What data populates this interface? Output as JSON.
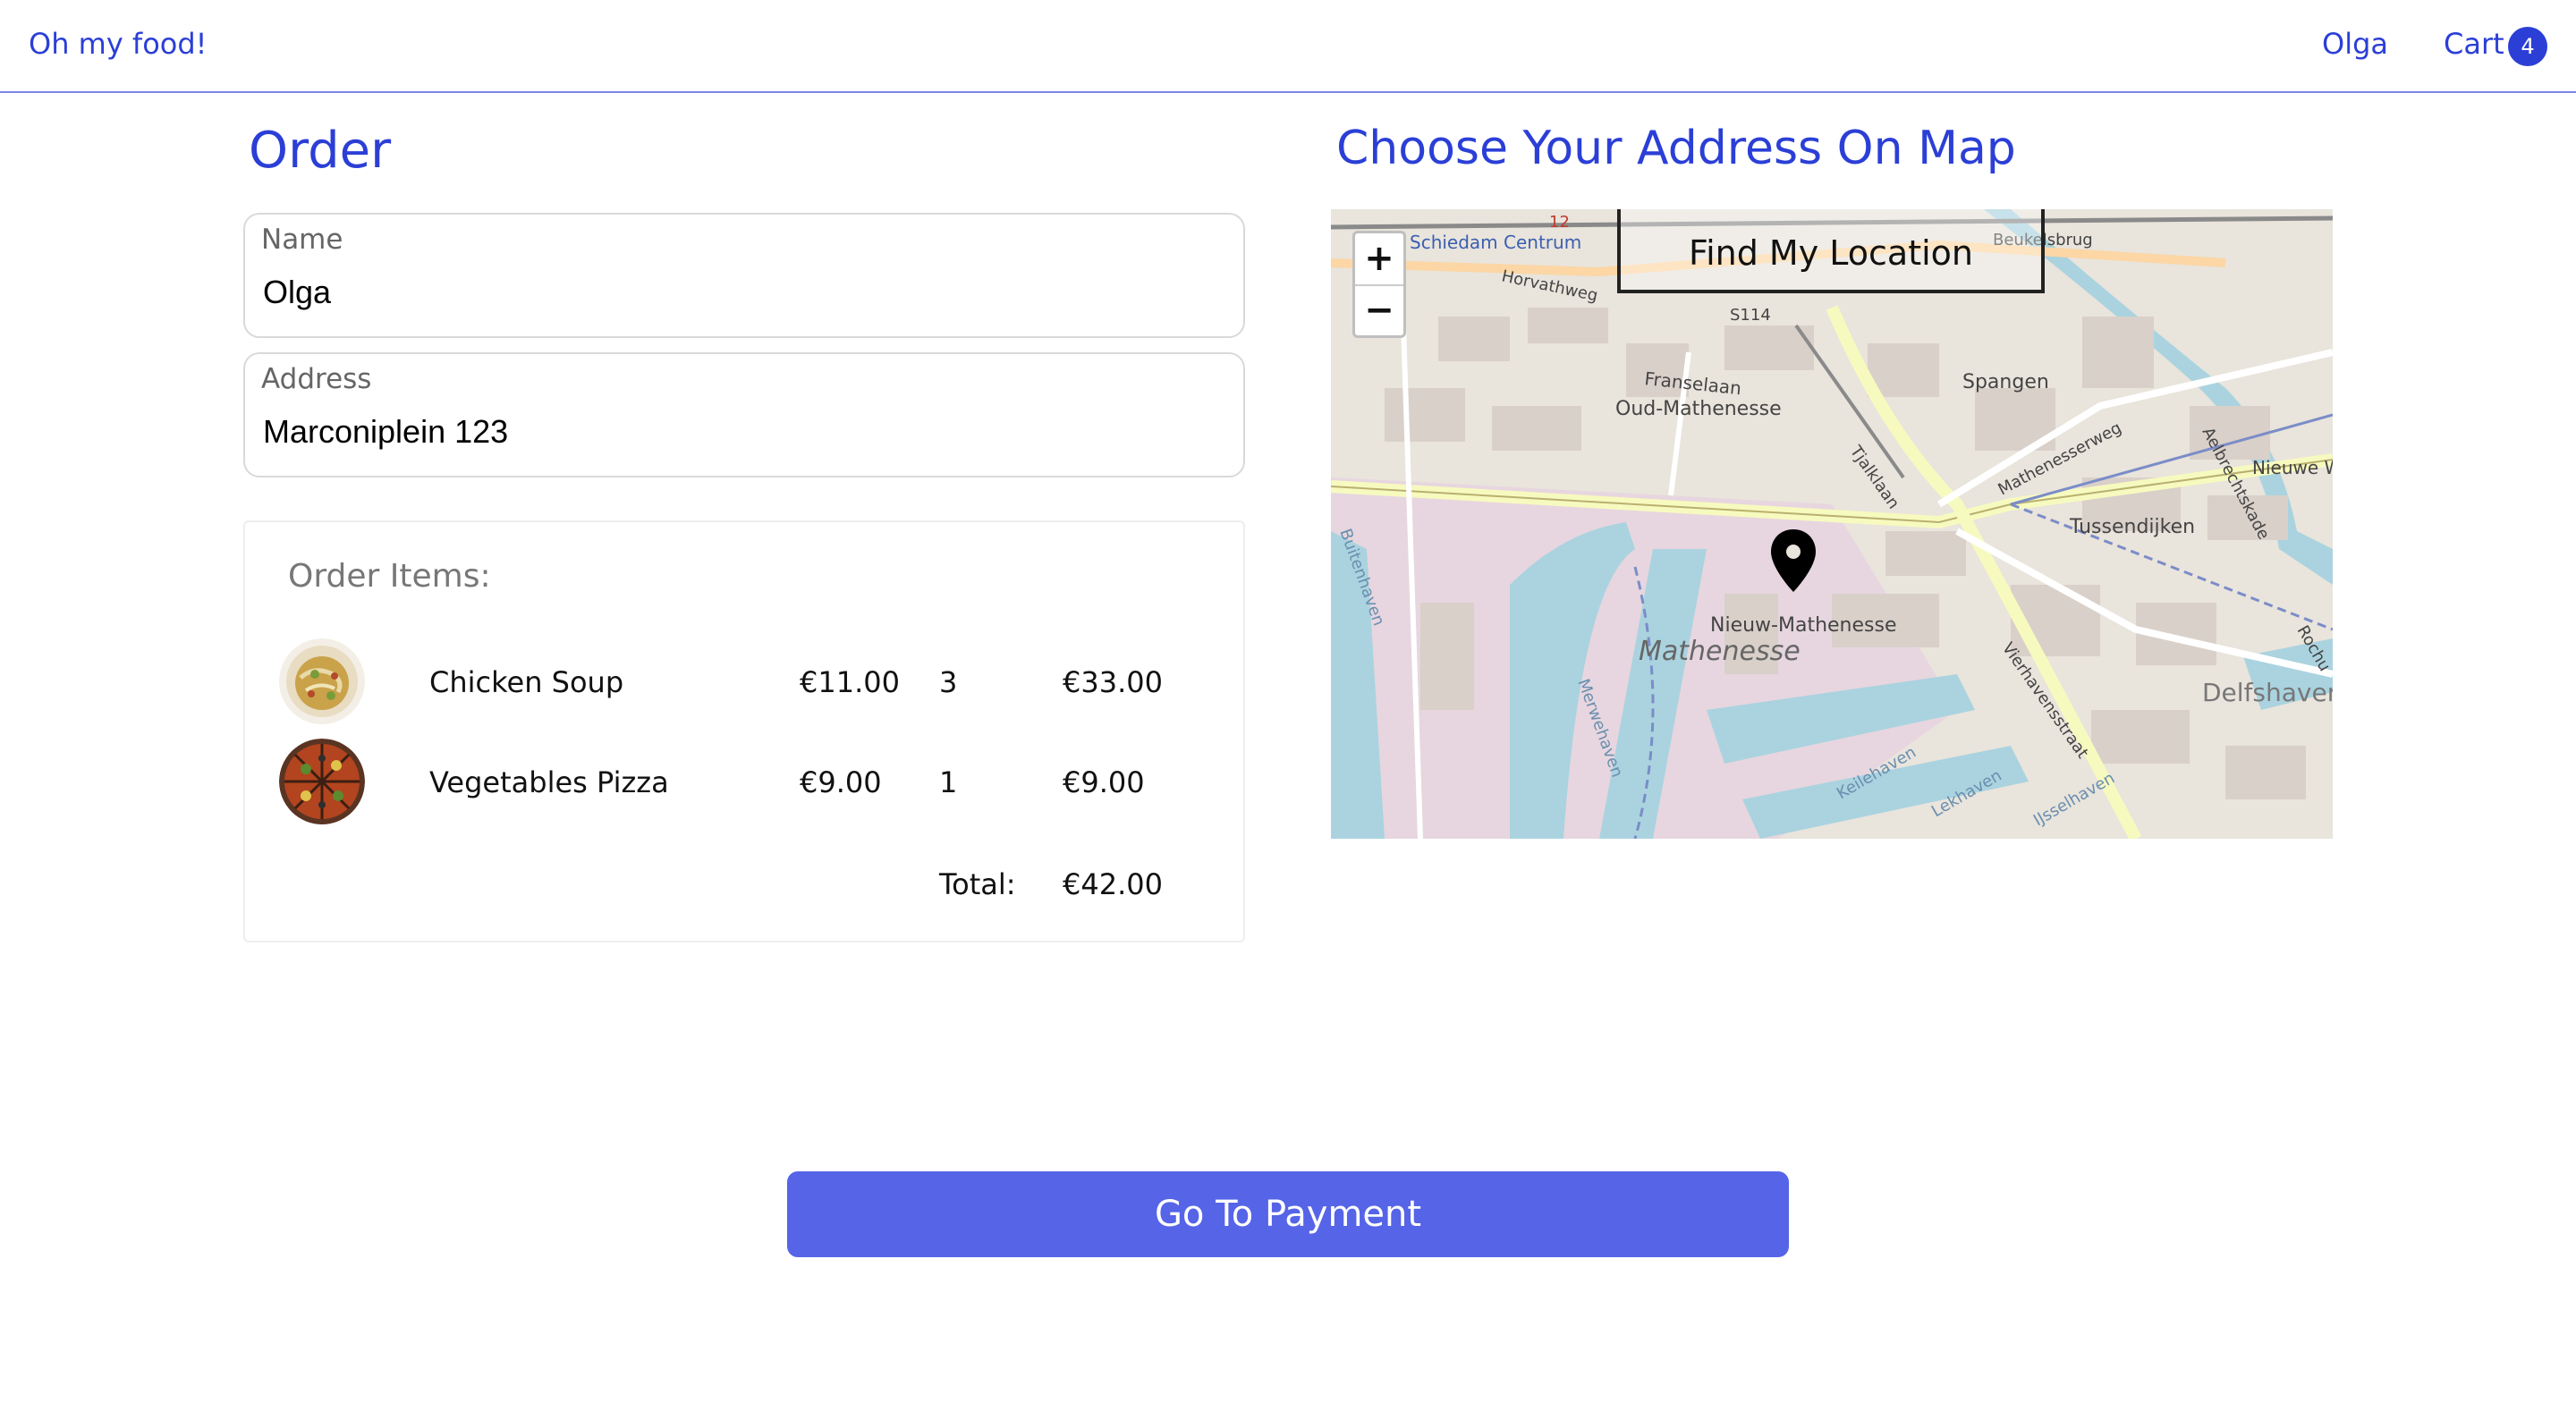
{
  "nav": {
    "brand": "Oh my food!",
    "user": "Olga",
    "cart_label": "Cart",
    "cart_count": "4"
  },
  "order": {
    "heading": "Order",
    "name_label": "Name",
    "name_value": "Olga",
    "address_label": "Address",
    "address_value": "Marconiplein 123",
    "items_title": "Order Items:",
    "items": [
      {
        "name": "Chicken Soup",
        "price": "€11.00",
        "qty": "3",
        "subtotal": "€33.00",
        "image": "chicken-soup-photo"
      },
      {
        "name": "Vegetables Pizza",
        "price": "€9.00",
        "qty": "1",
        "subtotal": "€9.00",
        "image": "vegetables-pizza-photo"
      }
    ],
    "total_label": "Total:",
    "total_value": "€42.00"
  },
  "map": {
    "heading": "Choose Your Address On Map",
    "zoom_in": "+",
    "zoom_out": "−",
    "find_location": "Find My Location",
    "labels": [
      "Schiedam Centrum",
      "Horvathweg",
      "S114",
      "Franselaan",
      "Oud-Mathenesse",
      "Spangen",
      "Mathenesserweg",
      "Tussendijken",
      "Nieuw-Mathenesse",
      "Mathenesse",
      "Delfshaven",
      "Vierhavensstraat",
      "Keilehaven",
      "Lekhaven",
      "IJsselhaven",
      "Merwehaven",
      "Buitenhaven",
      "Beukelsbrug",
      "Aelbrechtskade",
      "Tjalklaan",
      "Nieuwe W",
      "12",
      "Rochu"
    ],
    "marker_icon": "map-marker-icon"
  },
  "payment": {
    "button_label": "Go To Payment"
  },
  "colors": {
    "accent": "#2b3fd6",
    "button": "#5664e8"
  }
}
